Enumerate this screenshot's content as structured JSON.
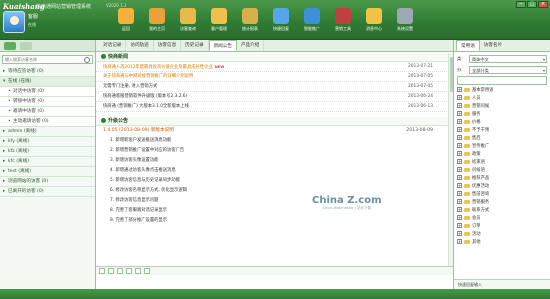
{
  "app": {
    "brand": "Kuaishang",
    "title": "快商通网站营销管理系统",
    "version": "V2020 1.2",
    "window_controls": [
      "−",
      "□",
      "×"
    ]
  },
  "user": {
    "name": "客服",
    "status": "在线"
  },
  "toolbar": [
    {
      "label": "返回",
      "icon": "back-arrow-icon",
      "color": "#f6b03b"
    },
    {
      "label": "我的主页",
      "icon": "home-folder-icon",
      "color": "#e8a13b"
    },
    {
      "label": "访客查询",
      "icon": "search-folder-icon",
      "color": "#e8b84a"
    },
    {
      "label": "客户管理",
      "icon": "customer-card-icon",
      "color": "#f0c04e"
    },
    {
      "label": "统计报表",
      "icon": "bar-chart-icon",
      "color": "#d8b04a"
    },
    {
      "label": "快捷回复",
      "icon": "quick-reply-icon",
      "color": "#56a7e6"
    },
    {
      "label": "智能推广",
      "icon": "robot-icon",
      "color": "#3d8fd8"
    },
    {
      "label": "营销工具",
      "icon": "toolbox-icon",
      "color": "#c04040"
    },
    {
      "label": "消息中心",
      "icon": "message-icon",
      "color": "#f2c345"
    },
    {
      "label": "系统设置",
      "icon": "settings-gear-icon",
      "color": "#9aa9b5"
    }
  ],
  "left": {
    "search_placeholder": "输入搜索访客名称",
    "groups": [
      {
        "label": "等待应答访客 (0)",
        "kind": "group"
      },
      {
        "label": "在线 (在线)",
        "kind": "open"
      },
      {
        "label": "对话中访客 (0)",
        "kind": "sub"
      },
      {
        "label": "转接中访客 (0)",
        "kind": "sub"
      },
      {
        "label": "邀请中访客 (0)",
        "kind": "sub"
      },
      {
        "label": "主动邀请访客 (0)",
        "kind": "sub"
      },
      {
        "label": "admin (离线)",
        "kind": "group"
      },
      {
        "label": "kfy (离线)",
        "kind": "group"
      },
      {
        "label": "kfz (离线)",
        "kind": "group"
      },
      {
        "label": "kfc (离线)",
        "kind": "group"
      },
      {
        "label": "test (离线)",
        "kind": "group"
      },
      {
        "label": "浏览网站的访客 (0)",
        "kind": "group"
      },
      {
        "label": "已离开的访客 (0)",
        "kind": "group"
      }
    ]
  },
  "center": {
    "tabs": [
      "对话记录",
      "访问轨迹",
      "访客信息",
      "历史记录",
      "新闻公告",
      "产品介绍"
    ],
    "active_tab": 4,
    "news_title": "快商新闻",
    "news": [
      {
        "text": "快商通入选2013年度最具投资价值企业及最具成长性企业",
        "date": "2013-07-21",
        "hot": true,
        "new": "NEW"
      },
      {
        "text": "关于快商通与中网对接营销推广的详细介绍说明",
        "date": "2013-07-05",
        "hot": true
      },
      {
        "text": "无需专门注册, 进入营销方式",
        "date": "2013-07-05"
      },
      {
        "text": "快商通客服营销软件升级版 (版本号2.3.2.6)",
        "date": "2013-06-24"
      },
      {
        "text": "快商通 (营销推广) 大版本3.1.0全新版本上线",
        "date": "2013-06-13"
      }
    ],
    "bulletin_title": "升级公告",
    "bulletin_head": "1.4.05 (2013-08-09) 新版本说明",
    "bulletin_date": "2013-08-09",
    "bulletin": [
      "1. 新增新客户发送推送消息功能",
      "2. 新增营销推广设置中对应的访客广告",
      "3. 新增访客头像设置功能",
      "4. 新增通过访客头像点击推送消息",
      "5. 新增访客信息与历史记录同步功能",
      "6. 修改访客名称显示方式, 优化显示逻辑",
      "7. 修改访客信息显示问题",
      "8. 完善了客服端对话记录显示",
      "9. 完善了部分推广设置的显示"
    ],
    "watermark_main": "China Z.com",
    "watermark_sub": "China Webmaster | 站长下载"
  },
  "right": {
    "tabs": [
      "常用语",
      "访客名片"
    ],
    "lang_label": "类:",
    "lang_value": "简体中文",
    "cat_label": "分:",
    "cat_value": "全部分类",
    "categories": [
      "基本常用语",
      "人员",
      "营销问候",
      "服务",
      "价格",
      "不予干预",
      "售后",
      "宣传推广",
      "政策",
      "结束语",
      "问候语",
      "推荐产品",
      "优惠活动",
      "售前咨询",
      "营销服务",
      "联系方式",
      "会员",
      "订单",
      "活动",
      "其他"
    ],
    "bottom_label": "快速回复输入"
  }
}
